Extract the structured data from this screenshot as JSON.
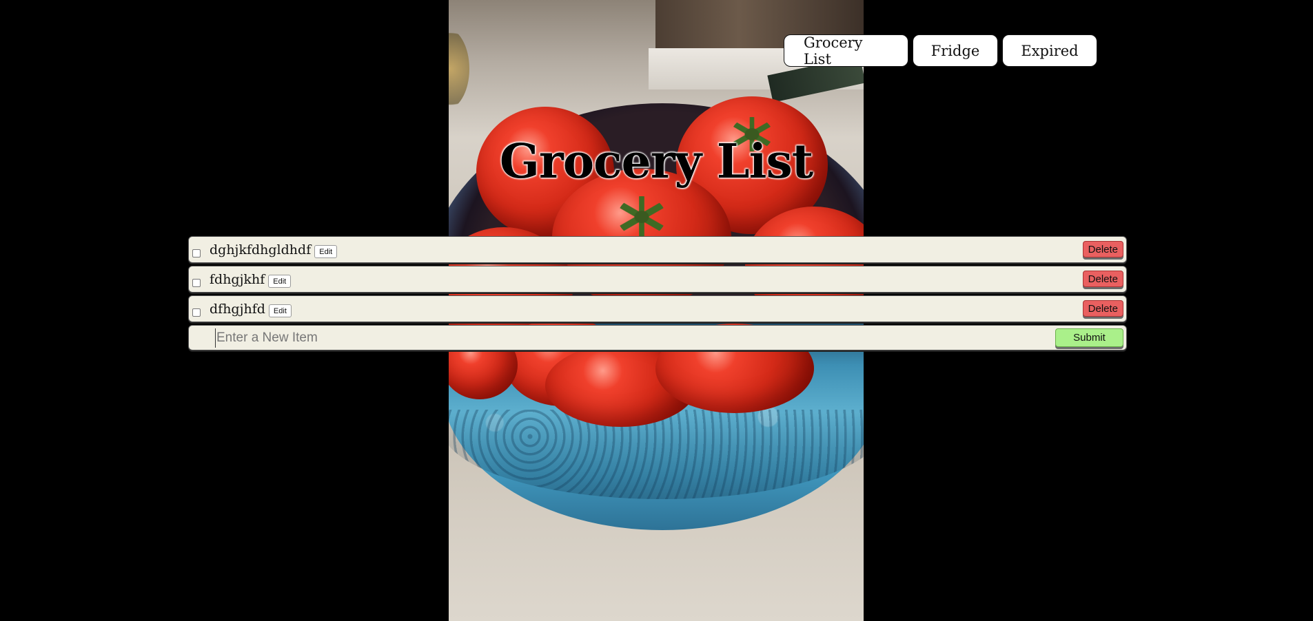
{
  "nav": {
    "tabs": [
      {
        "label": "Grocery List"
      },
      {
        "label": "Fridge"
      },
      {
        "label": "Expired"
      }
    ]
  },
  "title": "Grocery List",
  "items": [
    {
      "name": "dghjkfdhgldhdf",
      "edit_label": "Edit",
      "delete_label": "Delete",
      "checked": false
    },
    {
      "name": "fdhgjkhf",
      "edit_label": "Edit",
      "delete_label": "Delete",
      "checked": false
    },
    {
      "name": "dfhgjhfd",
      "edit_label": "Edit",
      "delete_label": "Delete",
      "checked": false
    }
  ],
  "new_item": {
    "placeholder": "Enter a New Item",
    "value": "",
    "submit_label": "Submit"
  },
  "colors": {
    "row_bg": "#f1efe3",
    "delete": "#e96060",
    "submit": "#aaf08a",
    "page_bg": "#000000"
  }
}
